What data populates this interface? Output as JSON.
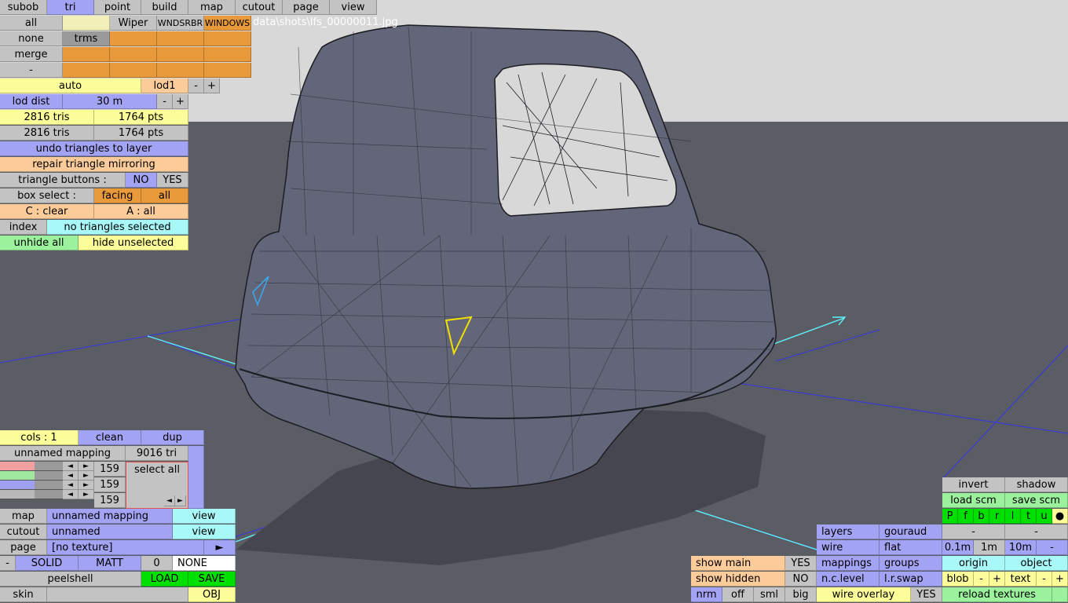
{
  "top_tabs": [
    "subob",
    "tri",
    "point",
    "build",
    "map",
    "cutout",
    "page",
    "view"
  ],
  "active_tab": "tri",
  "file_path": "data\\shots\\lfs_00000011.jpg",
  "sel": {
    "all": "all",
    "none": "none",
    "trms": "trms",
    "merge": "merge",
    "minus": "-",
    "wiper": "Wiper",
    "wndsrbr": "WNDSRBR",
    "windows": "WINDOWS"
  },
  "lod": {
    "auto": "auto",
    "lod1": "lod1",
    "minus": "-",
    "plus": "+",
    "lod_dist_label": "lod dist",
    "lod_dist_value": "30 m"
  },
  "counts": {
    "tris1": "2816 tris",
    "pts1": "1764 pts",
    "tris2": "2816 tris",
    "pts2": "1764 pts"
  },
  "actions": {
    "undo": "undo triangles to layer",
    "repair": "repair triangle mirroring",
    "tri_buttons": "triangle buttons :",
    "no": "NO",
    "yes": "YES",
    "box_select": "box select :",
    "facing": "facing",
    "all": "all",
    "c_clear": "C : clear",
    "a_all": "A : all",
    "index": "index",
    "none_selected": "no triangles selected",
    "unhide_all": "unhide all",
    "hide_unselected": "hide unselected"
  },
  "mapping": {
    "cols": "cols : 1",
    "clean": "clean",
    "dup": "dup",
    "unnamed_mapping": "unnamed mapping",
    "tri_count": "9016 tri",
    "left": "◄",
    "right": "►",
    "v1": "159",
    "v2": "159",
    "v3": "159",
    "select_all": "select all",
    "sliders": [
      0.55,
      0.55,
      0.55,
      0.55
    ]
  },
  "bottom_left": {
    "map": "map",
    "map_value": "unnamed mapping",
    "view": "view",
    "cutout": "cutout",
    "cutout_value": "unnamed",
    "page": "page",
    "page_value": "[no texture]",
    "play": "►",
    "minus": "-",
    "solid": "SOLID",
    "matt": "MATT",
    "zero": "0",
    "none": "NONE",
    "peelshell": "peelshell",
    "load": "LOAD",
    "save": "SAVE",
    "skin": "skin",
    "obj": "OBJ"
  },
  "bottom_mid": {
    "show_main": "show main",
    "show_main_val": "YES",
    "show_hidden": "show hidden",
    "show_hidden_val": "NO",
    "nrm": "nrm",
    "off": "off",
    "sml": "sml",
    "big": "big"
  },
  "bottom_right": {
    "invert": "invert",
    "shadow": "shadow",
    "load_scm": "load scm",
    "save_scm": "save scm",
    "letters": [
      "P",
      "f",
      "b",
      "r",
      "l",
      "t",
      "u",
      "●"
    ],
    "layers": "layers",
    "gouraud": "gouraud",
    "dash": "-",
    "wire": "wire",
    "flat": "flat",
    "d01": "0.1m",
    "d1": "1m",
    "d10": "10m",
    "dminus": "-",
    "mappings": "mappings",
    "groups": "groups",
    "origin": "origin",
    "object": "object",
    "nclevel": "n.c.level",
    "lrswap": "l.r.swap",
    "blob": "blob",
    "text": "text",
    "minus": "-",
    "plus": "+",
    "wire_overlay": "wire overlay",
    "wire_overlay_val": "YES",
    "reload": "reload textures"
  },
  "colors": {
    "ground": "#5b5d64",
    "sky": "#d8d8d8",
    "car": "#626678",
    "grid_line": "#3c3ccc",
    "axis_x": "#5ff2ff",
    "yellow_tri": "#f2e000",
    "blue_tri": "#3aaaf0"
  }
}
